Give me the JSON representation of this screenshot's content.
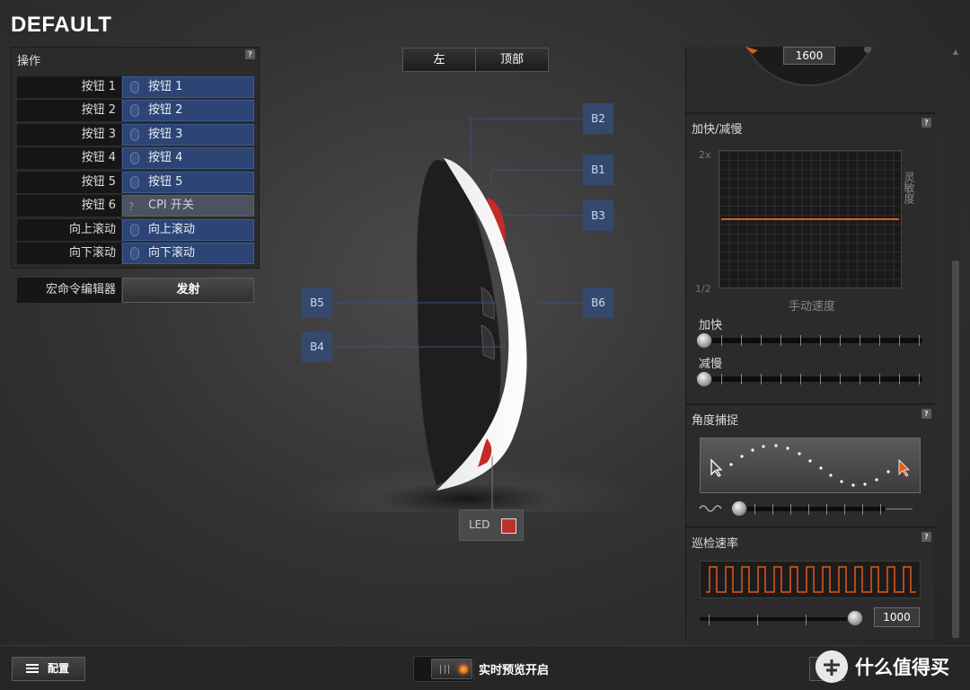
{
  "profile_title": "DEFAULT",
  "left_panel": {
    "title": "操作",
    "help": "?",
    "rows": [
      {
        "label": "按钮 1",
        "value": "按钮 1"
      },
      {
        "label": "按钮 2",
        "value": "按钮 2"
      },
      {
        "label": "按钮 3",
        "value": "按钮 3"
      },
      {
        "label": "按钮 4",
        "value": "按钮 4"
      },
      {
        "label": "按钮 5",
        "value": "按钮 5"
      },
      {
        "label": "按钮 6",
        "value": "CPI 开关"
      },
      {
        "label": "向上滚动",
        "value": "向上滚动"
      },
      {
        "label": "向下滚动",
        "value": "向下滚动"
      }
    ],
    "macro_label": "宏命令编辑器",
    "macro_button": "发射"
  },
  "view_toggle": {
    "left": "左",
    "top": "顶部"
  },
  "tags": {
    "b1": "B1",
    "b2": "B2",
    "b3": "B3",
    "b4": "B4",
    "b5": "B5",
    "b6": "B6"
  },
  "led": {
    "label": "LED",
    "color": "#c0302a"
  },
  "right_panel": {
    "dpi_value": "1600",
    "accel": {
      "title": "加快/减慢",
      "help": "?",
      "y_top": "2x",
      "y_bottom": "1/2",
      "x_label": "手动速度",
      "y_label": "灵敏度",
      "accel_label": "加快",
      "decel_label": "减慢"
    },
    "angle": {
      "title": "角度捕捉",
      "help": "?"
    },
    "polling": {
      "title": "巡检速率",
      "help": "?",
      "value": "1000"
    }
  },
  "bottom": {
    "config_label": "配置",
    "live_preview_label": "实时预览开启"
  },
  "watermark": "什么值得买",
  "colors": {
    "accent": "#e25a18",
    "button_blue": "#2c4575"
  }
}
